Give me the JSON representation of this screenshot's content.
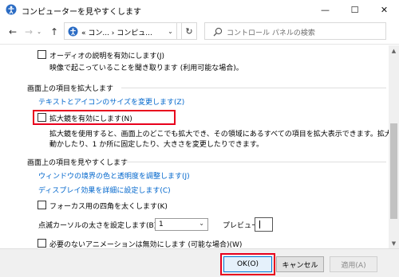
{
  "window": {
    "title": "コンピューターを見やすくします",
    "minimize": "—",
    "maximize": "☐",
    "close": "✕"
  },
  "nav": {
    "back": "←",
    "forward": "→",
    "up": "↑",
    "address_text": "« コン... › コンピュ...",
    "address_dropdown": "⌄",
    "refresh": "↻",
    "search_placeholder": "コントロール パネルの検索"
  },
  "sections": {
    "audio": {
      "checkbox_label": "オーディオの説明を有効にします(J)",
      "description": "映像で起こっていることを聞き取ります (利用可能な場合)。"
    },
    "magnify": {
      "heading": "画面上の項目を拡大します",
      "link": "テキストとアイコンのサイズを変更します(Z)",
      "checkbox_label": "拡大鏡を有効にします(N)",
      "description_line1": "拡大鏡を使用すると、画面上のどこでも拡大でき、その領域にあるすべての項目を拡大表示できます。拡大鏡は、",
      "description_line2": "動かしたり、1 か所に固定したり、大きさを変更したりできます。"
    },
    "visibility": {
      "heading": "画面上の項目を見やすくします",
      "link1": "ウィンドウの境界の色と透明度を調整します(J)",
      "link2": "ディスプレイ効果を詳細に設定します(C)",
      "focus_checkbox_label": "フォーカス用の四角を太くします(K)",
      "cursor_label": "点滅カーソルの太さを設定します(B):",
      "cursor_value": "1",
      "preview_label": "プレビュー:",
      "animation_checkbox_label": "必要のないアニメーションは無効にします (可能な場合)(W)"
    }
  },
  "buttons": {
    "ok": "OK(O)",
    "cancel": "キャンセル",
    "apply": "適用(A)"
  },
  "colors": {
    "link": "#0066cc",
    "highlight": "#e8001c",
    "ok_border": "#0078d7"
  }
}
